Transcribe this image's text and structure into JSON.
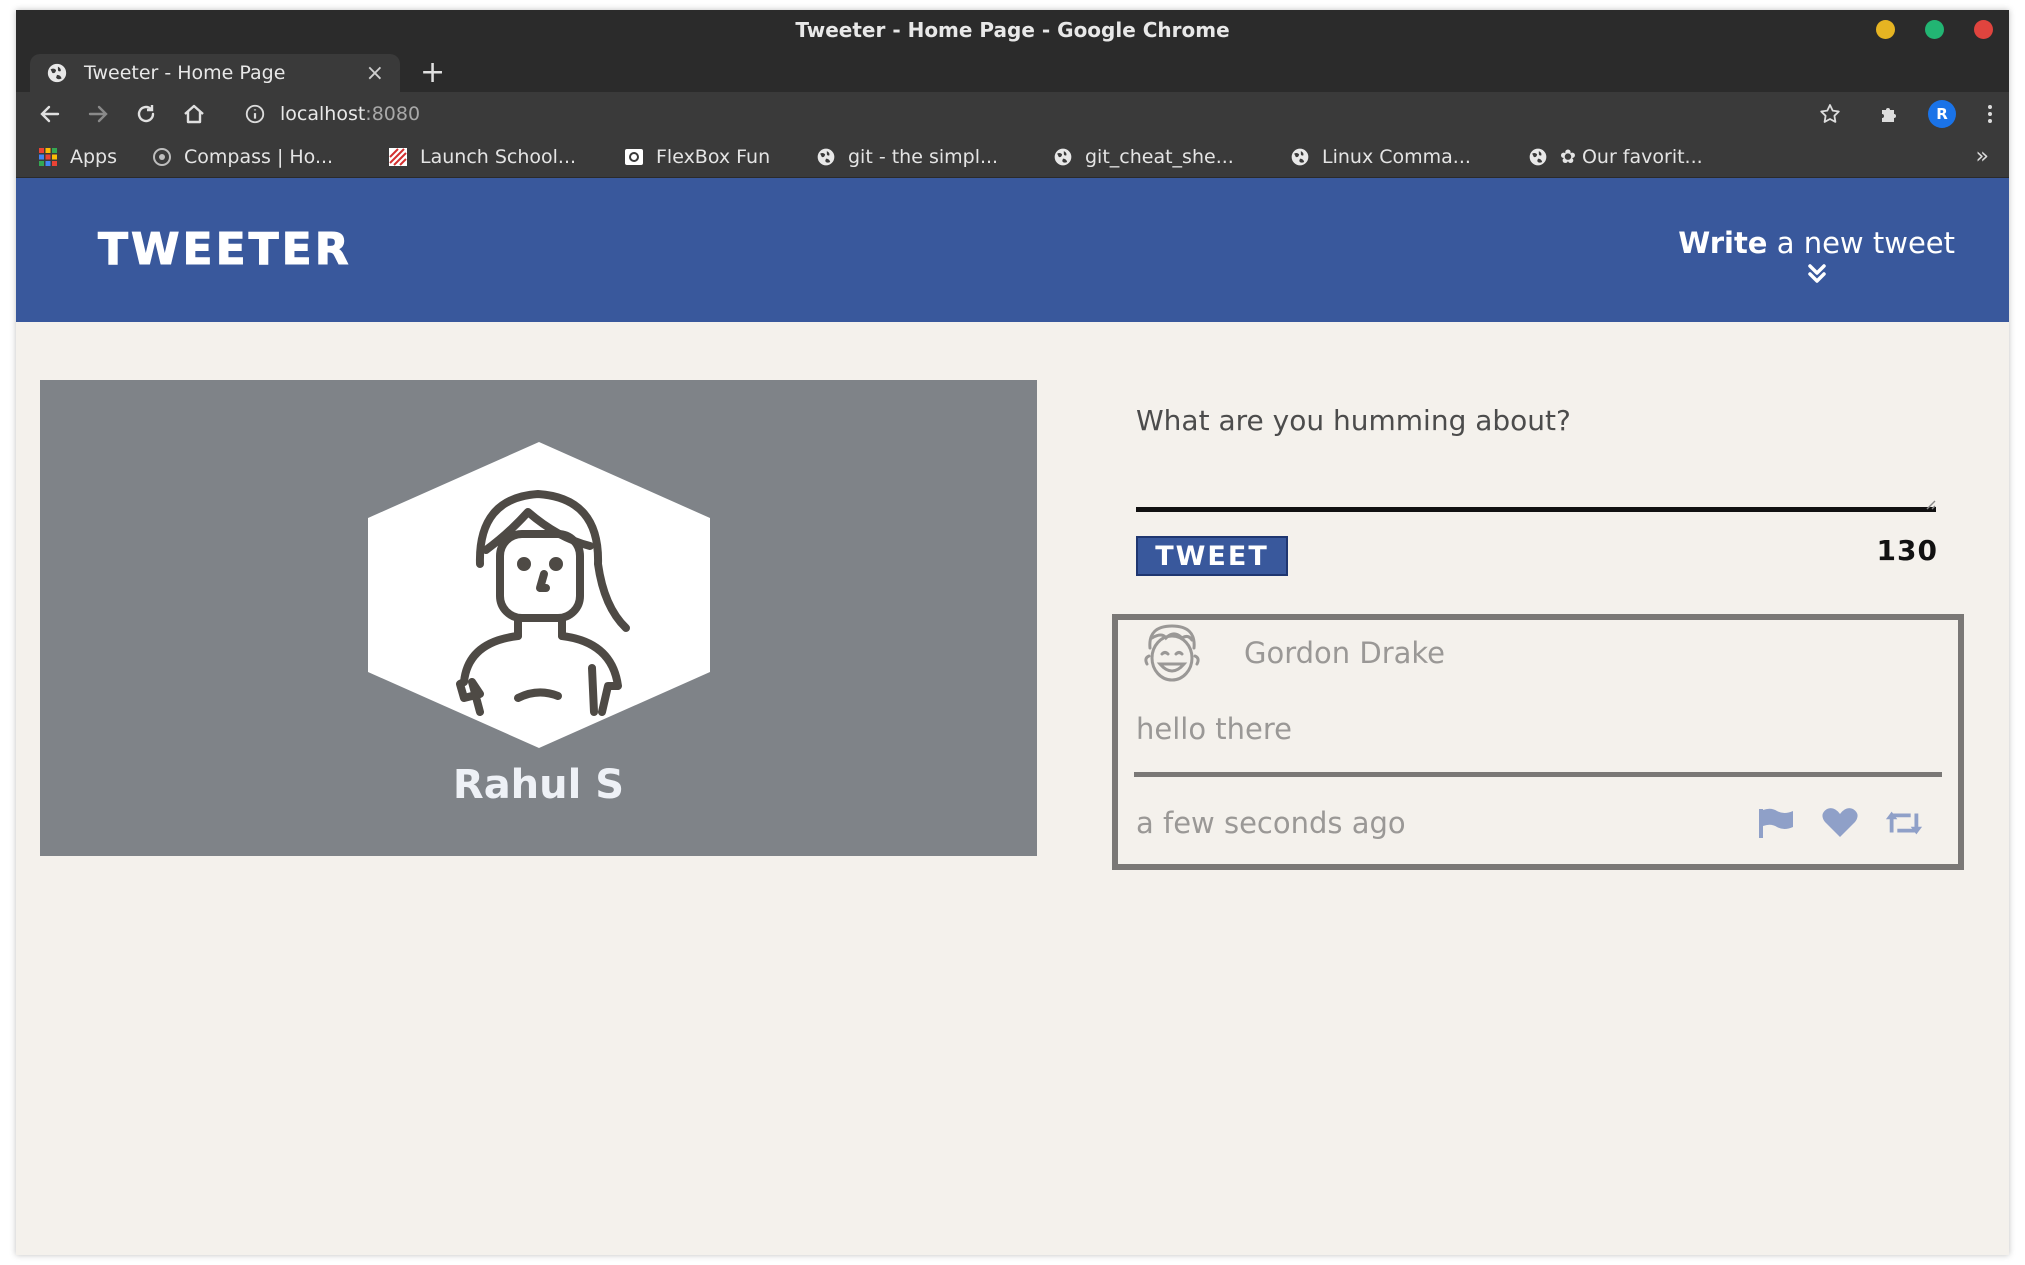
{
  "browser": {
    "window_title": "Tweeter - Home Page - Google Chrome",
    "tab_title": "Tweeter - Home Page",
    "tab_close_glyph": "×",
    "new_tab_glyph": "+",
    "url_host": "localhost",
    "url_port": ":8080",
    "profile_initial": "R",
    "bookmarks": [
      {
        "label": "Apps",
        "icon": "apps-grid-icon"
      },
      {
        "label": "Compass | Ho...",
        "icon": "compass-icon"
      },
      {
        "label": "Launch School...",
        "icon": "launch-school-icon"
      },
      {
        "label": "FlexBox Fun",
        "icon": "flexbox-icon"
      },
      {
        "label": "git - the simpl...",
        "icon": "globe-icon"
      },
      {
        "label": "git_cheat_she...",
        "icon": "globe-icon"
      },
      {
        "label": "Linux Comma...",
        "icon": "globe-icon"
      },
      {
        "label": "✿ Our favorit...",
        "icon": "globe-icon"
      }
    ],
    "bookmarks_overflow": "»",
    "window_controls": {
      "minimize": "#e6b422",
      "maximize": "#22b573",
      "close": "#e0443e"
    }
  },
  "nav": {
    "logo": "TWEETER",
    "write_bold": "Write",
    "write_rest": " a new tweet",
    "brand_color": "#39589c"
  },
  "profile": {
    "name": "Rahul S"
  },
  "compose": {
    "placeholder": "What are you humming about?",
    "button_label": "TWEET",
    "counter": "130"
  },
  "tweet": {
    "author": "Gordon Drake",
    "content": "hello there",
    "timestamp": "a few seconds ago",
    "actions": [
      "flag-icon",
      "heart-icon",
      "retweet-icon"
    ],
    "action_color": "#8fa0c8"
  }
}
